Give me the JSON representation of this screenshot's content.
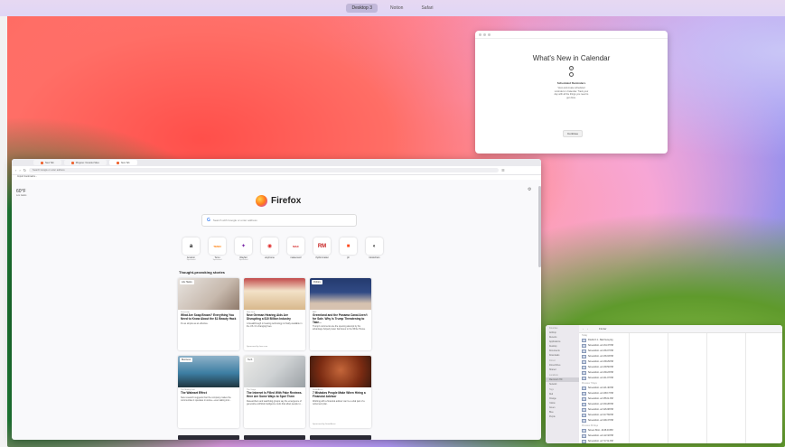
{
  "topbar": {
    "items": [
      "Desktop 3",
      "Notion",
      "Safari"
    ],
    "active_index": 0
  },
  "calendar": {
    "title": "What's New in Calendar",
    "feature_title": "Scheduled Reminders",
    "feature_desc": "View and create scheduled reminders in Calendar. Track your day with all the things you need to get done.",
    "continue_label": "Continue"
  },
  "firefox": {
    "tabs": [
      {
        "label": "New Tab"
      },
      {
        "label": "Ringerer. Neviolet Sites"
      },
      {
        "label": "New Tab"
      }
    ],
    "url_placeholder": "Search Google or enter address",
    "bookmarks_label": "Import bookmarks...",
    "weather": {
      "temp": "60°F",
      "location": "Los Gatos"
    },
    "brand": "Firefox",
    "search_placeholder": "Search with Google or enter address",
    "shortcuts": [
      {
        "label": "Amazon",
        "sponsored": "Sponsored",
        "glyph": "a",
        "color": "#111111"
      },
      {
        "label": "Temu",
        "sponsored": "Sponsored",
        "glyph": "TEMU",
        "color": "#ff7a00"
      },
      {
        "label": "Wayfair",
        "sponsored": "Sponsored",
        "glyph": "✦",
        "color": "#7b2aa8"
      },
      {
        "label": "etsyhome",
        "sponsored": "",
        "glyph": "◉",
        "color": "#e02b2b"
      },
      {
        "label": "makeover2",
        "sponsored": "",
        "glyph": "MAC",
        "color": "#d11a1a"
      },
      {
        "label": "rhythmmatter",
        "sponsored": "",
        "glyph": "RM",
        "color": "#c62020"
      },
      {
        "label": "jbl",
        "sponsored": "",
        "glyph": "■",
        "color": "#ff4b1f"
      },
      {
        "label": "blockchain",
        "sponsored": "",
        "glyph": "◐",
        "color": "#222222"
      }
    ],
    "stories_heading": "Thought-provoking stories",
    "stories": [
      {
        "badge": "Life Hacks",
        "source": "Distractify",
        "title": "What Are Soap Brows? Everything You Need to Know About the $1 Beauty Hack",
        "desc": "It's as simple as an effective.",
        "sponsored": ""
      },
      {
        "badge": "",
        "source": "New Line",
        "title": "New German Hearing Aids Are Disrupting a $10 Billion Industry",
        "desc": "A breakthrough in hearing technology is finally available in the US. It's changing lives.",
        "sponsored": "Sponsored by hear.com"
      },
      {
        "badge": "Politics",
        "source": "BBC",
        "title": "Greenland and the Panama Canal Aren't for Sale. Why Is Trump Threatening to Take...",
        "desc": "Trump's comments are the opening attempt by his advantage helped power fast lanes to the White House.",
        "sponsored": ""
      },
      {
        "badge": "Business",
        "source": "The Motley Fool",
        "title": "The Walmart Effect",
        "desc": "New research suggests that the company makes the communities it operates in worse—even taking into...",
        "sponsored": ""
      },
      {
        "badge": "Tech",
        "source": "The Verge",
        "title": "The Internet Is Filled With Fake Reviews. Here Are Some Ways to Spot Them",
        "desc": "Researchers and watchdog groups say the emergence of generative artificial intelligence tools that allow people to...",
        "sponsored": ""
      },
      {
        "badge": "",
        "source": "SmartAsset",
        "title": "7 Mistakes People Make When Hiring a Financial Advisor",
        "desc": "Working with a financial advisor can be a vital part of a retirement plan.",
        "sponsored": "Sponsored by SmartAsset"
      }
    ]
  },
  "finder": {
    "title": "Finder",
    "sidebar": [
      {
        "head": "Favorites"
      },
      {
        "label": "AirDrop"
      },
      {
        "label": "Recents"
      },
      {
        "label": "Applications"
      },
      {
        "label": "Desktop"
      },
      {
        "label": "Documents"
      },
      {
        "label": "Downloads"
      },
      {
        "head": "iCloud"
      },
      {
        "label": "iCloud Drive"
      },
      {
        "label": "Shared"
      },
      {
        "head": "Locations"
      },
      {
        "label": "Macintosh HD",
        "selected": true
      },
      {
        "label": "Network"
      },
      {
        "head": "Tags"
      },
      {
        "label": "Red"
      },
      {
        "label": "Orange"
      },
      {
        "label": "Yellow"
      },
      {
        "label": "Green"
      },
      {
        "label": "Blue"
      },
      {
        "label": "Purple"
      }
    ],
    "groups": [
      {
        "name": "Today",
        "files": [
          "Firefox 0.1 - Start here.png",
          "Screenshot...at 4.34.47 PM",
          "Screenshot...at 4.36.07 PM",
          "Screenshot...at 4.36.03 PM",
          "Screenshot...at 4.38.29 PM",
          "Screenshot...at 4.38.50 PM",
          "Screenshot...at 4.39.23 PM",
          "Screenshot...at 4.41.07 PM"
        ]
      },
      {
        "name": "Previous 7 Days",
        "files": [
          "Screenshot...at 4.21.40 PM",
          "Screenshot...at 4.08.17 PM",
          "Screenshot...at 3.55.11 PM",
          "Screenshot...at 3.30.28 PM",
          "Screenshot...at 3.26.08 PM",
          "Screenshot...at 3.17.59 PM",
          "Screenshot...at 3.09.47 PM"
        ]
      },
      {
        "name": "Previous 30 Days",
        "files": [
          "Screen Shot...10.48.04 PM",
          "Screenshot...at 1.22.32 PM",
          "Screenshot...at 7.17.11 PM"
        ]
      }
    ]
  }
}
